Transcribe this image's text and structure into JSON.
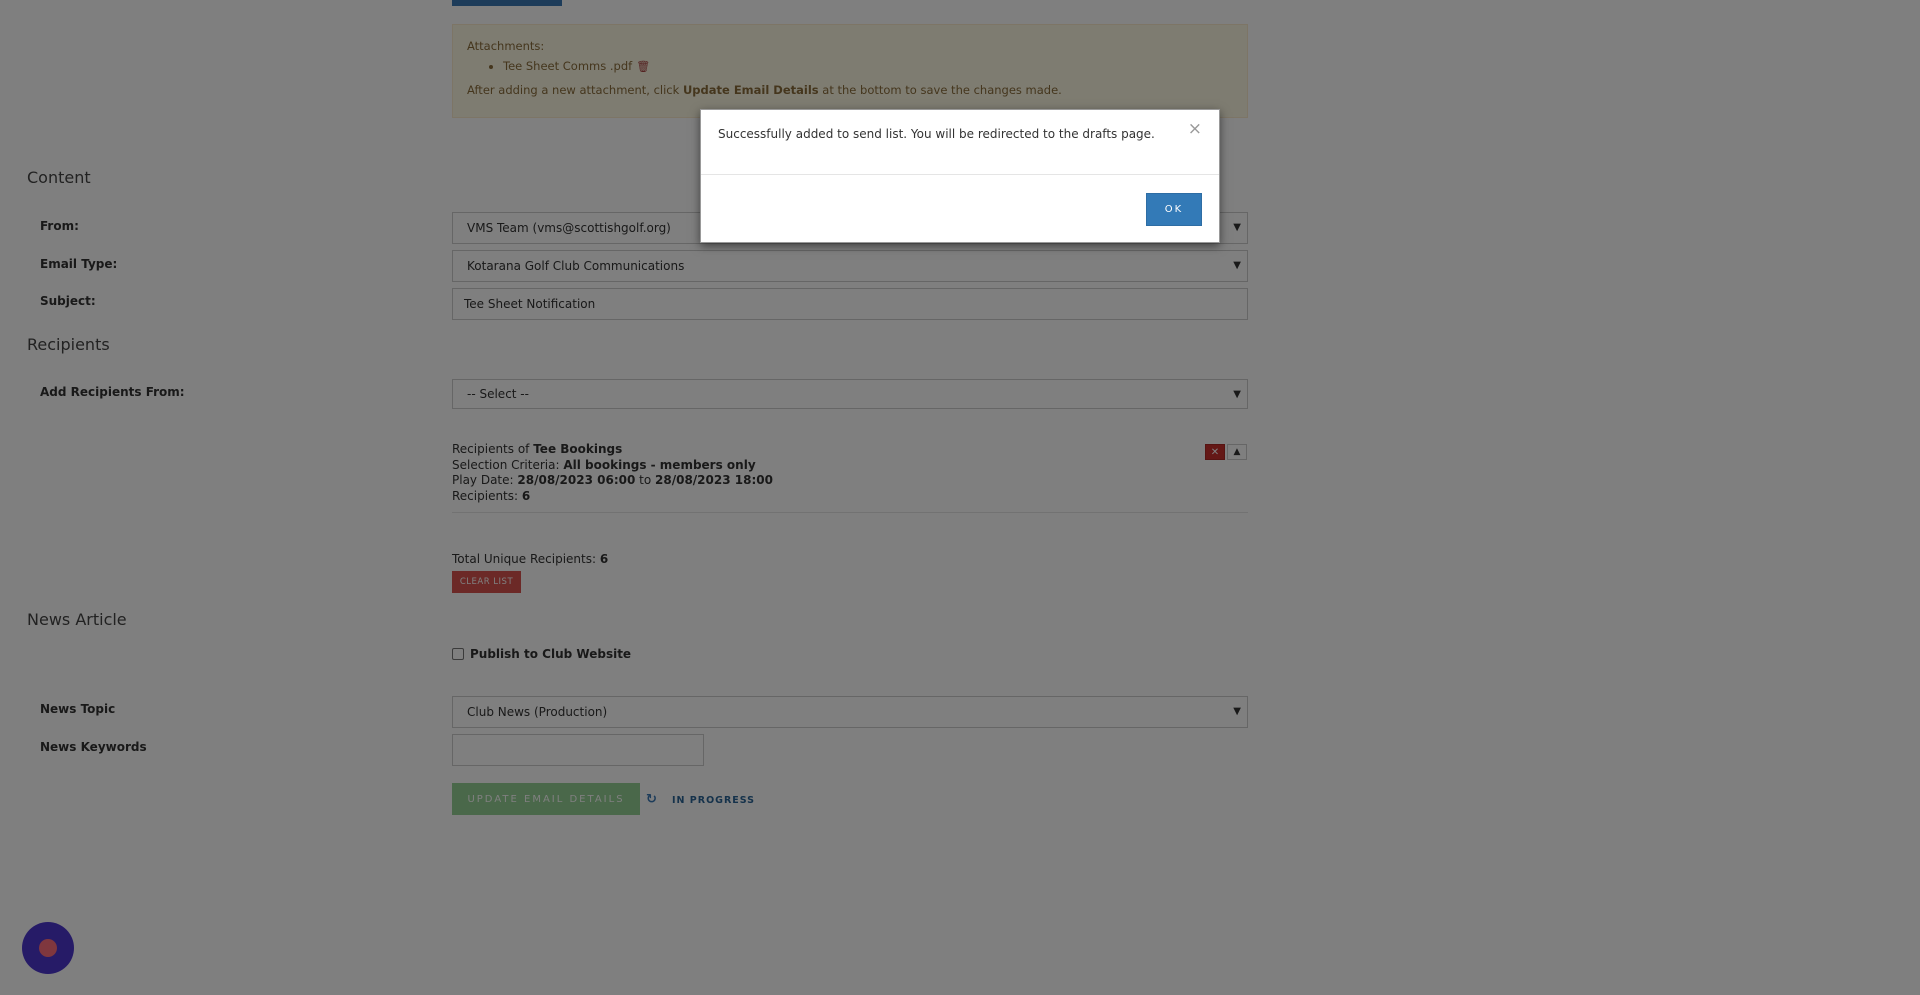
{
  "attachments": {
    "title": "Attachments:",
    "files": [
      {
        "name": "Tee Sheet Comms .pdf"
      }
    ],
    "note_prefix": "After adding a new attachment, click ",
    "note_bold": "Update Email Details",
    "note_suffix": " at the bottom to save the changes made."
  },
  "content": {
    "section_title": "Content",
    "from_label": "From:",
    "from_value": "VMS Team (vms@scottishgolf.org)",
    "email_type_label": "Email Type:",
    "email_type_value": "Kotarana Golf Club Communications",
    "subject_label": "Subject:",
    "subject_value": "Tee Sheet Notification"
  },
  "recipients": {
    "section_title": "Recipients",
    "add_from_label": "Add Recipients From:",
    "add_from_value": "-- Select --",
    "list": {
      "recipients_of_prefix": "Recipients of ",
      "source": "Tee Bookings",
      "criteria_prefix": "Selection Criteria: ",
      "criteria": "All bookings - members only",
      "play_date_prefix": "Play Date: ",
      "play_date_from": "28/08/2023 06:00",
      "play_date_to_word": " to ",
      "play_date_to": "28/08/2023 18:00",
      "count_prefix": "Recipients: ",
      "count": "6"
    },
    "total_prefix": "Total Unique Recipients: ",
    "total": "6",
    "clear_label": "CLEAR LIST"
  },
  "news": {
    "section_title": "News Article",
    "publish_label": "Publish to Club Website",
    "topic_label": "News Topic",
    "topic_value": "Club News (Production)",
    "keywords_label": "News Keywords",
    "keywords_value": ""
  },
  "actions": {
    "update_label": "UPDATE EMAIL DETAILS",
    "progress_label": "IN PROGRESS"
  },
  "modal": {
    "message": "Successfully added to send list. You will be redirected to the drafts page.",
    "close_glyph": "×",
    "ok_label": "OK"
  },
  "colors": {
    "primary": "#337ab7",
    "danger": "#d9534f",
    "success": "#5cb85c",
    "warning_bg": "#fcf8e3",
    "chat": "#4c36cf"
  }
}
